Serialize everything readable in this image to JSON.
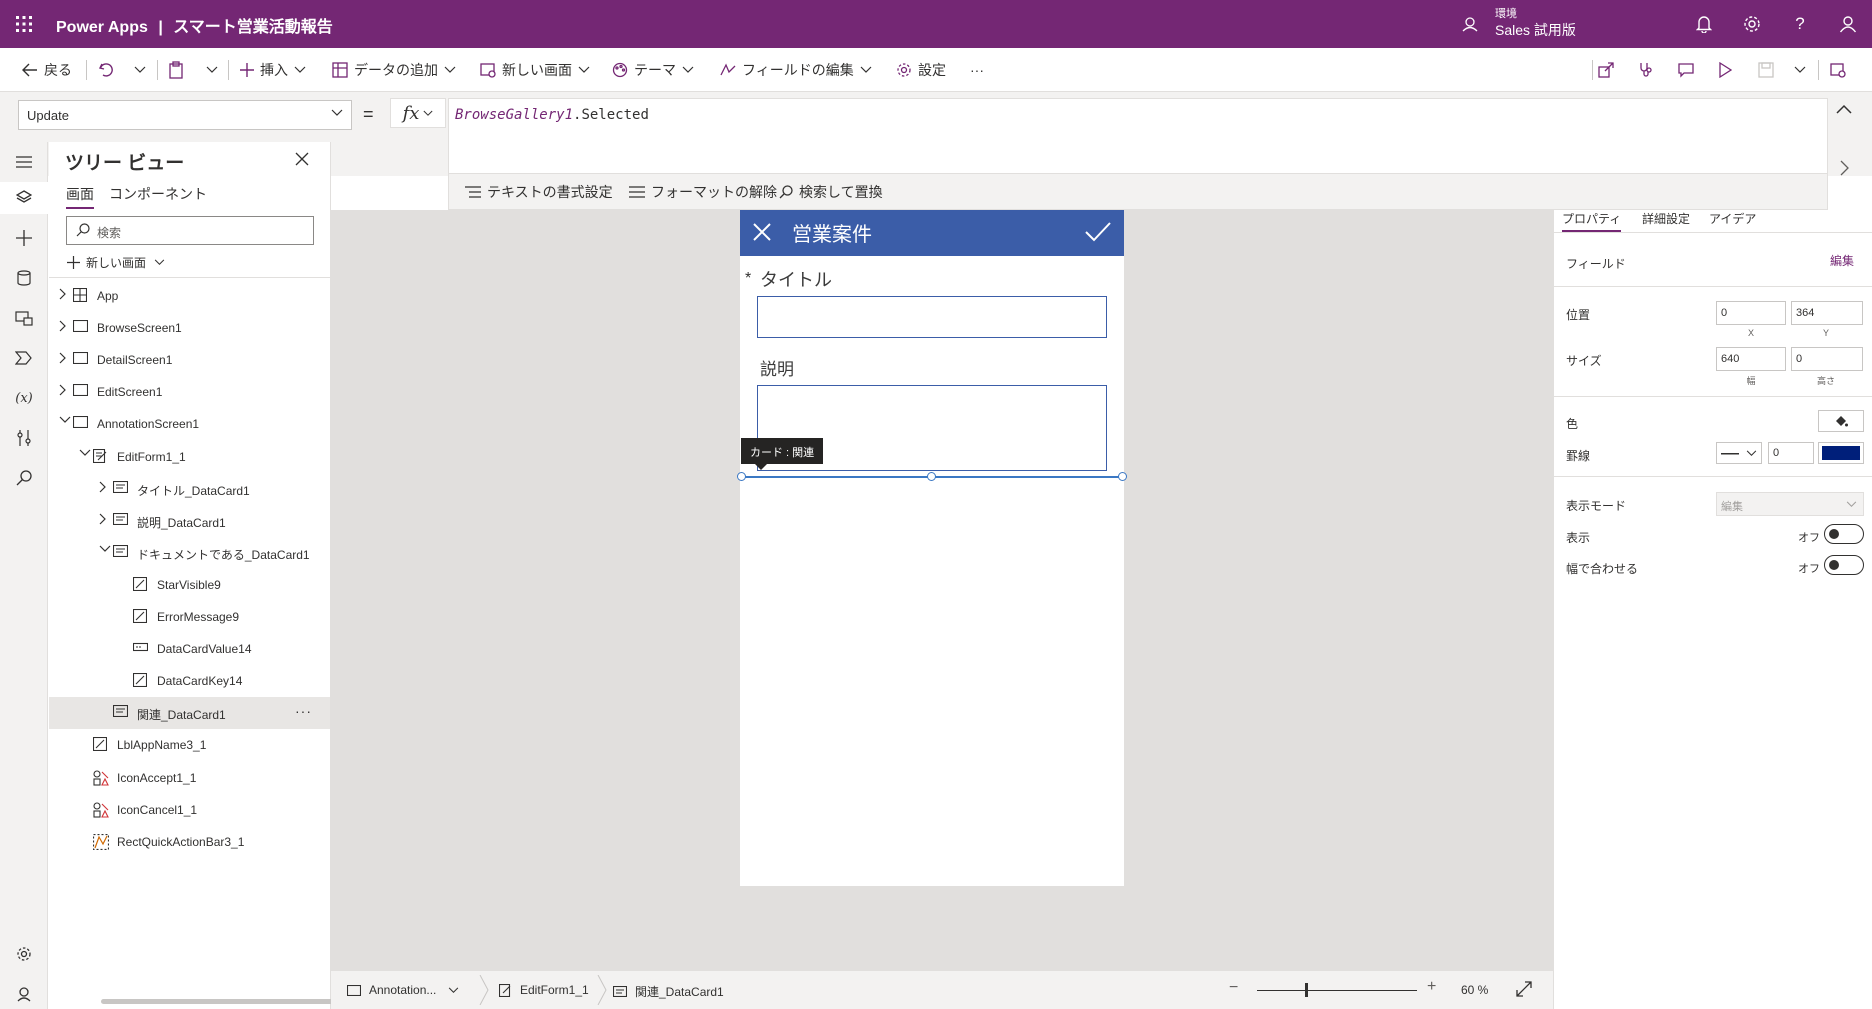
{
  "topbar": {
    "app_name": "Power Apps",
    "separator": "|",
    "project_title": "スマート営業活動報告",
    "env_label": "環境",
    "env_name": "Sales 試用版"
  },
  "commands": {
    "back": "戻る",
    "insert": "挿入",
    "add_data": "データの追加",
    "new_screen": "新しい画面",
    "theme": "テーマ",
    "edit_fields": "フィールドの編集",
    "settings": "設定",
    "more": "···"
  },
  "formula": {
    "property": "Update",
    "equals": "=",
    "fx": "fx",
    "object": "BrowseGallery1",
    "member": ".Selected",
    "format_text": "テキストの書式設定",
    "remove_format": "フォーマットの解除",
    "find_replace": "検索して置換"
  },
  "tree": {
    "title": "ツリー ビュー",
    "tab_screens": "画面",
    "tab_components": "コンポーネント",
    "search_placeholder": "検索",
    "new_screen": "新しい画面",
    "items": [
      {
        "label": "App",
        "icon": "app-icon"
      },
      {
        "label": "BrowseScreen1",
        "icon": "screen-icon"
      },
      {
        "label": "DetailScreen1",
        "icon": "screen-icon"
      },
      {
        "label": "EditScreen1",
        "icon": "screen-icon"
      },
      {
        "label": "AnnotationScreen1",
        "icon": "screen-icon"
      },
      {
        "label": "EditForm1_1",
        "icon": "form-icon"
      },
      {
        "label": "タイトル_DataCard1",
        "icon": "card-icon"
      },
      {
        "label": "説明_DataCard1",
        "icon": "card-icon"
      },
      {
        "label": "ドキュメントである_DataCard1",
        "icon": "card-icon"
      },
      {
        "label": "StarVisible9",
        "icon": "label-icon"
      },
      {
        "label": "ErrorMessage9",
        "icon": "label-icon"
      },
      {
        "label": "DataCardValue14",
        "icon": "textinput-icon"
      },
      {
        "label": "DataCardKey14",
        "icon": "label-icon"
      },
      {
        "label": "関連_DataCard1",
        "icon": "card-icon"
      },
      {
        "label": "LblAppName3_1",
        "icon": "label-icon"
      },
      {
        "label": "IconAccept1_1",
        "icon": "shapes-icon"
      },
      {
        "label": "IconCancel1_1",
        "icon": "shapes-icon"
      },
      {
        "label": "RectQuickActionBar3_1",
        "icon": "rectangle-icon"
      }
    ]
  },
  "form": {
    "header_title": "営業案件",
    "required_mark": "*",
    "title_label": "タイトル",
    "desc_label": "説明",
    "card_tooltip": "カード : 関連"
  },
  "status": {
    "crumb_screen": "Annotation...",
    "crumb_form": "EditForm1_1",
    "crumb_card": "関連_DataCard1",
    "zoom_minus": "−",
    "zoom_plus": "+",
    "zoom": "60 %",
    "zoom_fraction": 0.6
  },
  "props": {
    "tab_properties": "プロパティ",
    "tab_advanced": "詳細設定",
    "tab_ideas": "アイデア",
    "fields_label": "フィールド",
    "fields_edit": "編集",
    "position_label": "位置",
    "pos_x": "0",
    "pos_y": "364",
    "x_label": "X",
    "y_label": "Y",
    "size_label": "サイズ",
    "width": "640",
    "height": "0",
    "width_label": "幅",
    "height_label": "高さ",
    "color_label": "色",
    "border_label": "罫線",
    "border_width": "0",
    "border_color": "#001f7a",
    "display_mode_label": "表示モード",
    "display_mode_value": "編集",
    "visible_label": "表示",
    "visible_value": "オフ",
    "fit_width_label": "幅で合わせる",
    "fit_width_value": "オフ"
  }
}
